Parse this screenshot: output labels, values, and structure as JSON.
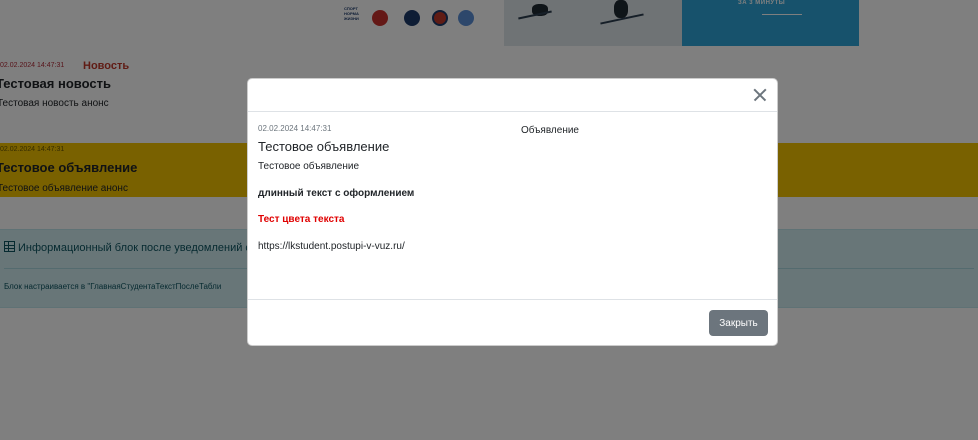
{
  "banner": {
    "logo_text": "СПОРТ НОРМА ЖИЗНИ",
    "caption": "ЗА 3 МИНУТЫ"
  },
  "news": {
    "date": "02.02.2024 14:47:31",
    "badge": "Новость",
    "title": "Тестовая новость",
    "anons": "Тестовая новость анонс"
  },
  "announcement": {
    "date": "02.02.2024 14:47:31",
    "title": "Тестовое объявление",
    "anons": "Тестовое объявление анонс"
  },
  "info_block": {
    "title": "Информационный блок после уведомлений ст",
    "note": "Блок настраивается в \"ГлавнаяСтудентаТекстПослеТабли"
  },
  "modal": {
    "date": "02.02.2024 14:47:31",
    "type": "Объявление",
    "title": "Тестовое объявление",
    "anons": "Тестовое объявление",
    "bold_text": "длинный текст с оформлением",
    "colored_text": "Тест цвета текста",
    "link": "https://lkstudent.postupi-v-vuz.ru/",
    "close_button": "Закрыть"
  },
  "colors": {
    "announcement_bg": "#f2c200",
    "info_bg": "#d1ecf1",
    "accent_red": "#e00000",
    "button_gray": "#6c757d"
  }
}
